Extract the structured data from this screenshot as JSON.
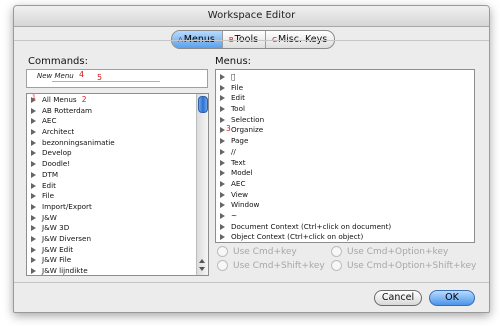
{
  "window": {
    "title": "Workspace Editor"
  },
  "tabs": [
    {
      "badge": "A",
      "label": "Menus",
      "active": true
    },
    {
      "badge": "B",
      "label": "Tools"
    },
    {
      "badge": "C",
      "label": "Misc. Keys"
    }
  ],
  "commands": {
    "label": "Commands:",
    "new_menu": {
      "label": "New Menu",
      "badge": "4",
      "field_badge": "5"
    },
    "list_badge": "1",
    "list_badge2": "2",
    "items": [
      "All Menus",
      "AB Rotterdam",
      "AEC",
      "Architect",
      "bezonningsanimatie",
      "Develop",
      "Doodle!",
      "DTM",
      "Edit",
      "File",
      "Import/Export",
      "J&W",
      "J&W 3D",
      "J&W Diversen",
      "J&W Edit",
      "J&W File",
      "J&W lijndikte"
    ]
  },
  "menus": {
    "label": "Menus:",
    "organize_badge": "3",
    "items": [
      "",
      "File",
      "Edit",
      "Tool",
      "Selection",
      "Organize",
      "Page",
      "//",
      "Text",
      "Model",
      "AEC",
      "View",
      "Window",
      "~",
      "Document Context (Ctrl+click on document)",
      "Object Context (Ctrl+click on object)"
    ]
  },
  "shortcuts": {
    "cmd_key": "Use Cmd+key",
    "cmd_option_key": "Use Cmd+Option+key",
    "cmd_shift_key": "Use Cmd+Shift+key",
    "cmd_option_shift_key": "Use Cmd+Option+Shift+key"
  },
  "buttons": {
    "cancel": "Cancel",
    "ok": "OK"
  }
}
